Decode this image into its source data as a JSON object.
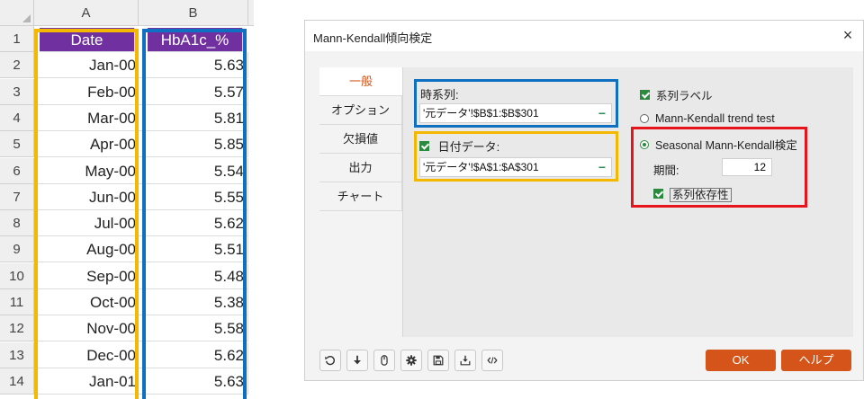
{
  "spreadsheet": {
    "columns": [
      "A",
      "B"
    ],
    "row_numbers": [
      "1",
      "2",
      "3",
      "4",
      "5",
      "6",
      "7",
      "8",
      "9",
      "10",
      "11",
      "12",
      "13",
      "14"
    ],
    "header": {
      "a": "Date",
      "b": "HbA1c_%"
    },
    "rows": [
      {
        "a": "Jan-00",
        "b": "5.63"
      },
      {
        "a": "Feb-00",
        "b": "5.57"
      },
      {
        "a": "Mar-00",
        "b": "5.81"
      },
      {
        "a": "Apr-00",
        "b": "5.85"
      },
      {
        "a": "May-00",
        "b": "5.54"
      },
      {
        "a": "Jun-00",
        "b": "5.55"
      },
      {
        "a": "Jul-00",
        "b": "5.62"
      },
      {
        "a": "Aug-00",
        "b": "5.51"
      },
      {
        "a": "Sep-00",
        "b": "5.48"
      },
      {
        "a": "Oct-00",
        "b": "5.38"
      },
      {
        "a": "Nov-00",
        "b": "5.58"
      },
      {
        "a": "Dec-00",
        "b": "5.62"
      },
      {
        "a": "Jan-01",
        "b": "5.63"
      }
    ],
    "colors": {
      "header_fill": "#7030a0",
      "highlight_a": "#f5b800",
      "highlight_b": "#0f6fc0"
    }
  },
  "dialog": {
    "title": "Mann-Kendall傾向検定",
    "close_icon": "×",
    "tabs": [
      "一般",
      "オプション",
      "欠損値",
      "出力",
      "チャート"
    ],
    "active_tab": "一般",
    "time_series": {
      "label": "時系列:",
      "value": "'元データ'!$B$1:$B$301",
      "remove": "−"
    },
    "date_data": {
      "label": "日付データ:",
      "checked": true,
      "value": "'元データ'!$A$1:$A$301",
      "remove": "−"
    },
    "series_label": {
      "label": "系列ラベル",
      "checked": true
    },
    "test_options": [
      {
        "label": "Mann-Kendall trend test",
        "selected": false
      },
      {
        "label": "Seasonal Mann-Kendall検定",
        "selected": true
      }
    ],
    "period": {
      "label": "期間:",
      "value": "12"
    },
    "serial_dependence": {
      "label": "系列依存性",
      "checked": true
    },
    "toolbar_icons": [
      "reset-icon",
      "download-icon",
      "mouse-icon",
      "gear-icon",
      "save-icon",
      "load-icon",
      "code-icon"
    ],
    "ok_label": "OK",
    "help_label": "ヘルプ",
    "colors": {
      "accent": "#d4541a",
      "check": "#2b8a3e",
      "seasonal_box": "#e8141b"
    }
  }
}
